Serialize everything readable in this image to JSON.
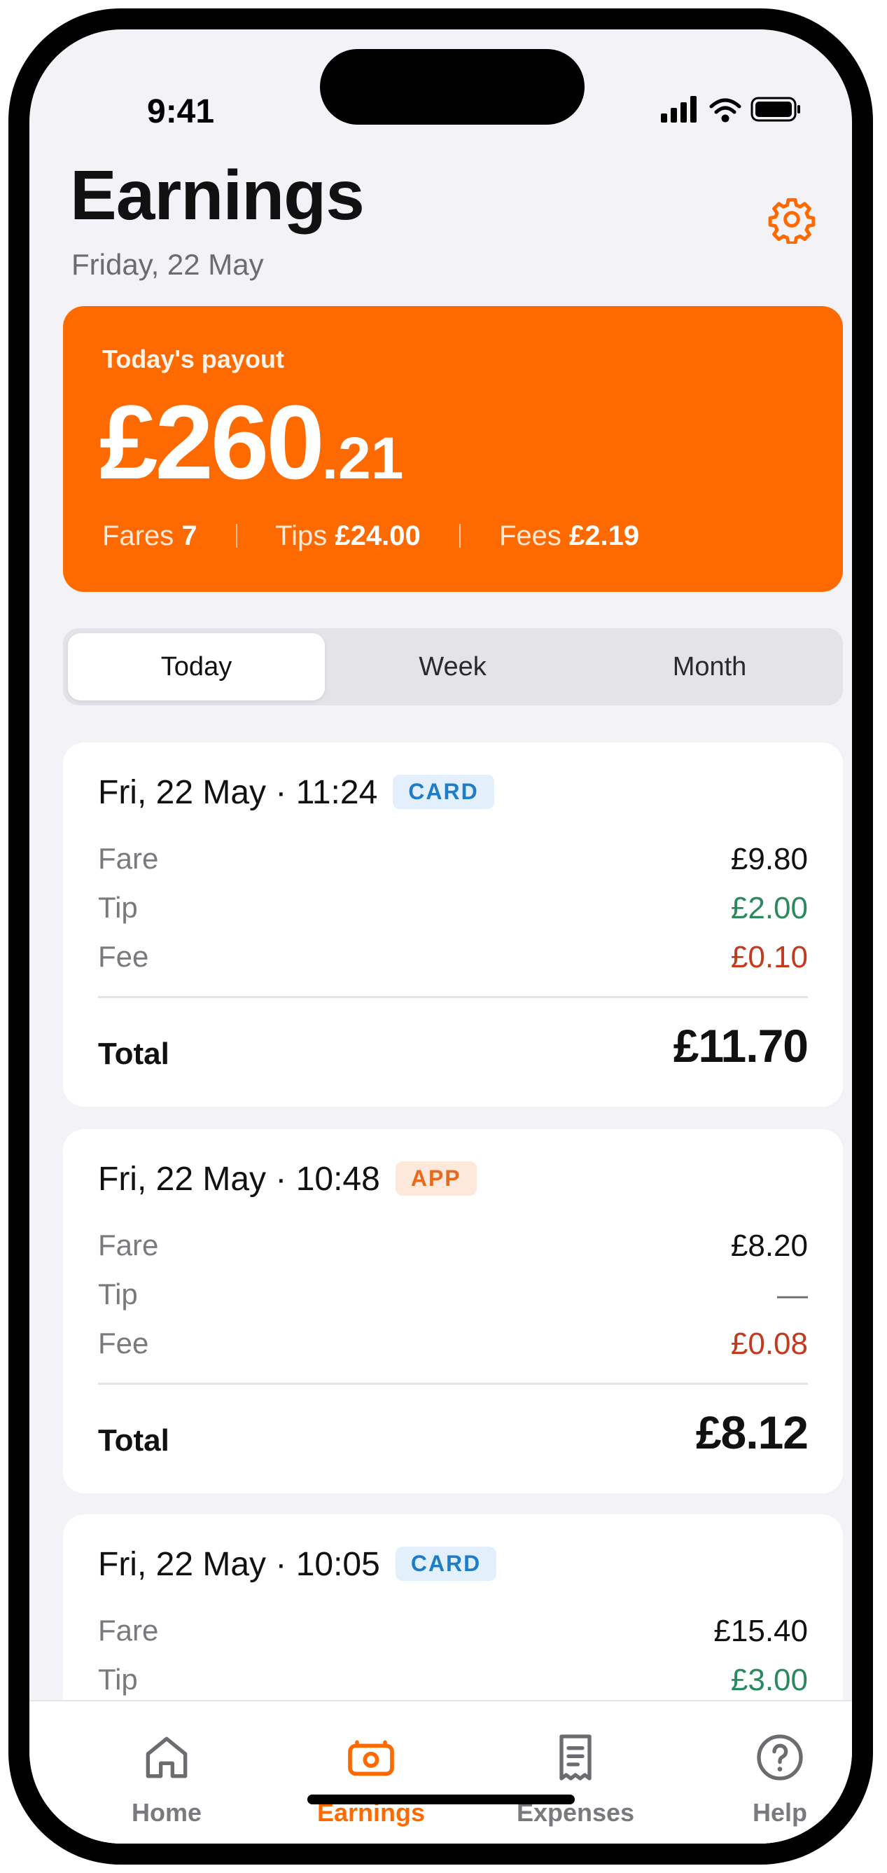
{
  "status_bar": {
    "time": "9:41"
  },
  "header": {
    "title": "Earnings",
    "date": "Friday, 22 May",
    "settings_icon": "gear-icon"
  },
  "payout": {
    "label": "Today's payout",
    "amount_main": "£260",
    "amount_cents": ".21",
    "fares_label": "Fares",
    "fares_value": "7",
    "tips_label": "Tips",
    "tips_value": "£24.00",
    "fees_label": "Fees",
    "fees_value": "£2.19"
  },
  "segments": [
    {
      "label": "Today",
      "active": true
    },
    {
      "label": "Week",
      "active": false
    },
    {
      "label": "Month",
      "active": false
    }
  ],
  "trips": [
    {
      "title": "Fri, 22 May · 11:24",
      "badge": "CARD",
      "fare_label": "Fare",
      "fare": "£9.80",
      "tip_label": "Tip",
      "tip": "£2.00",
      "fee_label": "Fee",
      "fee": "£0.10",
      "total_label": "Total",
      "total": "£11.70"
    },
    {
      "title": "Fri, 22 May · 10:48",
      "badge": "APP",
      "fare_label": "Fare",
      "fare": "£8.20",
      "tip_label": "Tip",
      "tip": "—",
      "fee_label": "Fee",
      "fee": "£0.08",
      "total_label": "Total",
      "total": "£8.12"
    },
    {
      "title": "Fri, 22 May · 10:05",
      "badge": "CARD",
      "fare_label": "Fare",
      "fare": "£15.40",
      "tip_label": "Tip",
      "tip": "£3.00"
    }
  ],
  "tabbar": [
    {
      "label": "Home",
      "icon": "home-icon",
      "active": false
    },
    {
      "label": "Earnings",
      "icon": "earnings-icon",
      "active": true
    },
    {
      "label": "Expenses",
      "icon": "receipt-icon",
      "active": false
    },
    {
      "label": "Help",
      "icon": "help-icon",
      "active": false
    }
  ],
  "colors": {
    "accent": "#ff6a00",
    "tip_green": "#2a8a5e",
    "fee_red": "#c23b1f",
    "card_badge": "#1e7cc8",
    "app_badge": "#e86b1d"
  }
}
